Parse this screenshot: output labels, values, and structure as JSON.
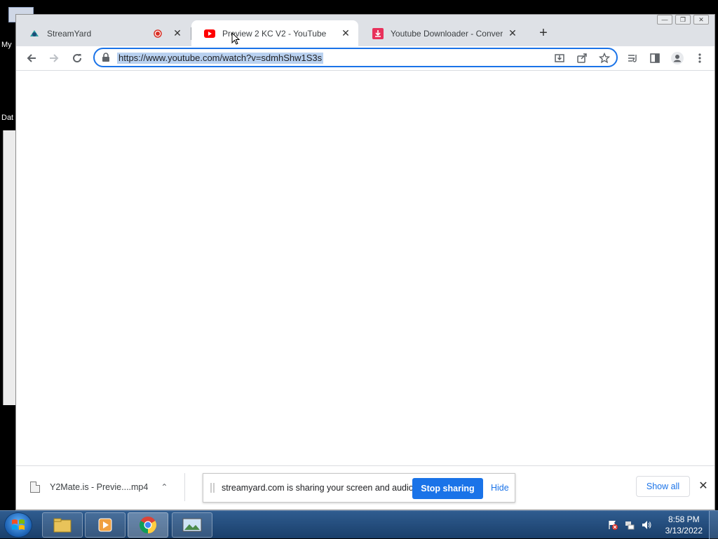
{
  "desktop": {
    "labels": [
      "My",
      "Dat"
    ]
  },
  "tabs": [
    {
      "title": "StreamYard",
      "icon": "streamyard-icon",
      "recording": true,
      "active": false
    },
    {
      "title": "Preview 2 KC V2 - YouTube",
      "icon": "youtube-icon",
      "active": true
    },
    {
      "title": "Youtube Downloader - Convert &",
      "icon": "download-icon",
      "active": false
    }
  ],
  "toolbar": {
    "url": "https://www.youtube.com/watch?v=sdmhShw1S3s"
  },
  "download": {
    "filename": "Y2Mate.is - Previe....mp4"
  },
  "share": {
    "message": "streamyard.com is sharing your screen and audio.",
    "stop_label": "Stop sharing",
    "hide_label": "Hide"
  },
  "download_bar": {
    "show_all_label": "Show all"
  },
  "taskbar": {
    "time": "8:58 PM",
    "date": "3/13/2022"
  },
  "colors": {
    "accent": "#1a73e8",
    "youtube_red": "#ff0000",
    "downloader_pink": "#e8315b"
  }
}
